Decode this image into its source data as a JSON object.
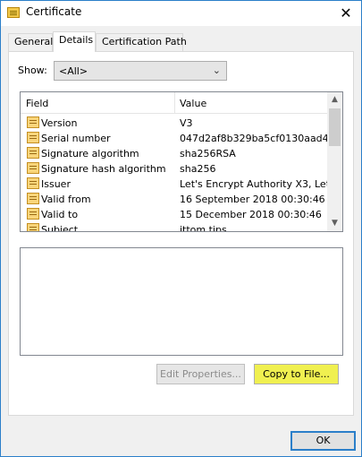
{
  "window": {
    "title": "Certificate"
  },
  "tabs": [
    {
      "label": "General"
    },
    {
      "label": "Details"
    },
    {
      "label": "Certification Path"
    }
  ],
  "show": {
    "label": "Show:",
    "selected": "<All>"
  },
  "list": {
    "headers": {
      "field": "Field",
      "value": "Value"
    },
    "rows": [
      {
        "field": "Version",
        "value": "V3"
      },
      {
        "field": "Serial number",
        "value": "047d2af8b329ba5cf0130aad4..."
      },
      {
        "field": "Signature algorithm",
        "value": "sha256RSA"
      },
      {
        "field": "Signature hash algorithm",
        "value": "sha256"
      },
      {
        "field": "Issuer",
        "value": "Let's Encrypt Authority X3, Let..."
      },
      {
        "field": "Valid from",
        "value": "16 September 2018 00:30:46"
      },
      {
        "field": "Valid to",
        "value": "15 December 2018 00:30:46"
      },
      {
        "field": "Subject",
        "value": "ittom.tips"
      }
    ]
  },
  "buttons": {
    "edit_properties": "Edit Properties...",
    "copy_to_file": "Copy to File...",
    "ok": "OK"
  },
  "colors": {
    "accent": "#2b7fc9",
    "highlight": "#f0f050"
  }
}
